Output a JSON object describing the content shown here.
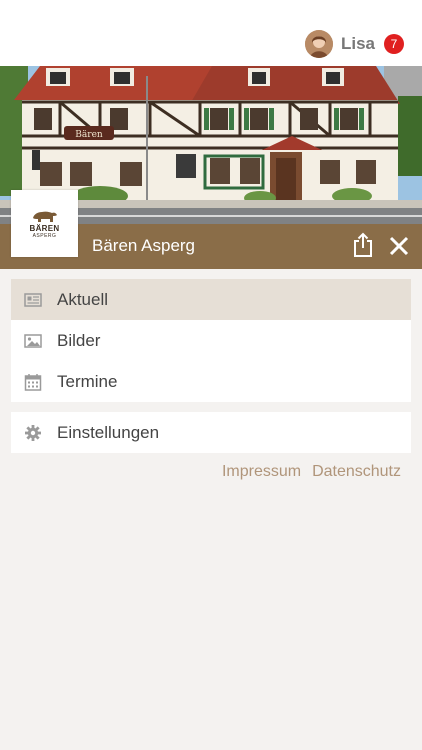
{
  "user": {
    "name": "Lisa",
    "notification_count": "7"
  },
  "venue": {
    "name": "Bären Asperg",
    "logo_line1": "BÄREN",
    "logo_line2": "ASPERG",
    "building_sign": "Bären"
  },
  "menu": {
    "main_items": [
      {
        "label": "Aktuell",
        "icon": "newspaper-icon",
        "active": true
      },
      {
        "label": "Bilder",
        "icon": "image-icon",
        "active": false
      },
      {
        "label": "Termine",
        "icon": "calendar-icon",
        "active": false
      }
    ],
    "settings_item": {
      "label": "Einstellungen",
      "icon": "gear-icon"
    }
  },
  "footer": {
    "impressum": "Impressum",
    "datenschutz": "Datenschutz"
  },
  "colors": {
    "brand_brown": "#8a6d48",
    "active_item_bg": "#e6dfd6",
    "badge_red": "#e02020",
    "link_color": "#b0957a",
    "page_bg": "#f4f2f0"
  }
}
